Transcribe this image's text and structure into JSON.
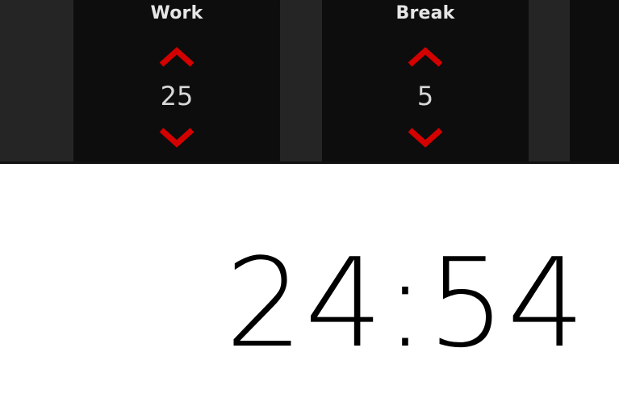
{
  "settings": {
    "work": {
      "label": "Work",
      "value": "25"
    },
    "break": {
      "label": "Break",
      "value": "5"
    }
  },
  "timer": {
    "display": "24:54"
  },
  "colors": {
    "accent": "#d40000",
    "panel": "#0d0d0d",
    "bar": "#252525"
  },
  "icons": {
    "increment": "chevron-up-icon",
    "decrement": "chevron-down-icon"
  }
}
